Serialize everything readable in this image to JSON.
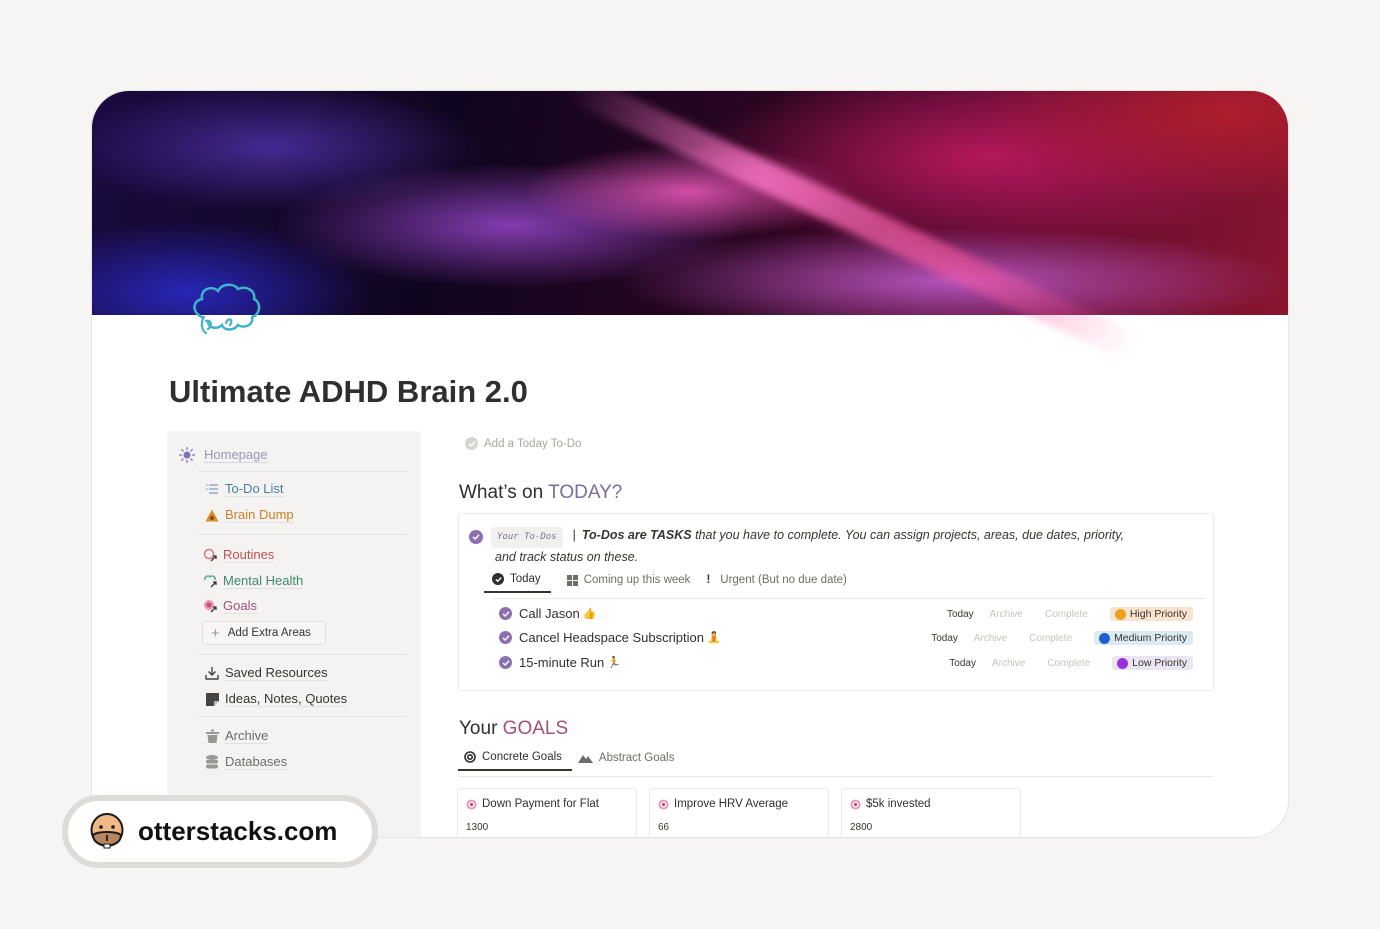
{
  "page": {
    "title": "Ultimate ADHD Brain 2.0",
    "cover": "abstract-purple-pink-wave",
    "icon": "brain-outline-icon"
  },
  "sidebar": {
    "home": {
      "label": "Homepage",
      "icon": "sun-icon"
    },
    "groups": [
      [
        {
          "label": "To-Do List",
          "icon": "list-icon",
          "color": "#4a7ea0"
        },
        {
          "label": "Brain Dump",
          "icon": "poop-warning-icon",
          "color": "#c7812a"
        }
      ],
      [
        {
          "label": "Routines",
          "icon": "routine-link-icon",
          "color": "#c0504e"
        },
        {
          "label": "Mental Health",
          "icon": "brain-link-icon",
          "color": "#3e8a6a"
        },
        {
          "label": "Goals",
          "icon": "target-link-icon",
          "color": "#a0507a"
        }
      ],
      [
        {
          "label": "Saved Resources",
          "icon": "download-icon",
          "color": "#37352f"
        },
        {
          "label": "Ideas, Notes, Quotes",
          "icon": "note-icon",
          "color": "#37352f"
        }
      ],
      [
        {
          "label": "Archive",
          "icon": "trash-icon",
          "color": "#6f6d69"
        },
        {
          "label": "Databases",
          "icon": "database-icon",
          "color": "#6f6d69"
        }
      ]
    ],
    "add_button": "Add Extra Areas"
  },
  "main": {
    "add_todo": "Add a Today To-Do",
    "today_heading": {
      "prefix": "What’s on ",
      "accent": "TODAY?"
    },
    "todo_block": {
      "chip": "Your To-Dos",
      "separator": "|",
      "bold": "To-Dos are TASKS",
      "desc_line1": " that you have to complete. You can assign projects, areas, due dates, priority,",
      "desc_line2": "and track status on these.",
      "tabs": [
        {
          "label": "Today",
          "icon": "check-circle-icon",
          "active": true
        },
        {
          "label": "Coming up this week",
          "icon": "grid-icon",
          "active": false
        },
        {
          "label": "Urgent (But no due date)",
          "icon": "exclamation-icon",
          "active": false
        }
      ],
      "rows": [
        {
          "title": "Call Jason",
          "emoji": "👍",
          "date": "Today",
          "archive": "Archive",
          "complete": "Complete",
          "priority": "High Priority",
          "priority_dot": "#f0a020",
          "priority_bg": "#fbe4cf"
        },
        {
          "title": "Cancel Headspace Subscription",
          "emoji": "🧘",
          "date": "Today",
          "archive": "Archive",
          "complete": "Complete",
          "priority": "Medium Priority",
          "priority_dot": "#1f5fd0",
          "priority_bg": "#dbeaf3"
        },
        {
          "title": "15-minute Run",
          "emoji": "🏃",
          "date": "Today",
          "archive": "Archive",
          "complete": "Complete",
          "priority": "Low Priority",
          "priority_dot": "#9b30e0",
          "priority_bg": "#ebe5f1"
        }
      ]
    },
    "goals_heading": {
      "prefix": "Your ",
      "accent": "GOALS"
    },
    "goal_tabs": [
      {
        "label": "Concrete Goals",
        "icon": "target-icon",
        "active": true
      },
      {
        "label": "Abstract Goals",
        "icon": "mountain-icon",
        "active": false
      }
    ],
    "goals": [
      {
        "title": "Down Payment for Flat",
        "value": "1300"
      },
      {
        "title": "Improve HRV Average",
        "value": "66"
      },
      {
        "title": "$5k invested",
        "value": "2800"
      }
    ]
  },
  "watermark": {
    "text": "otterstacks.com",
    "icon": "otter-face-icon"
  },
  "colors": {
    "today_accent": "#7b6c9e",
    "goals_accent": "#a0507a",
    "check_purple": "#8b6fb0"
  }
}
